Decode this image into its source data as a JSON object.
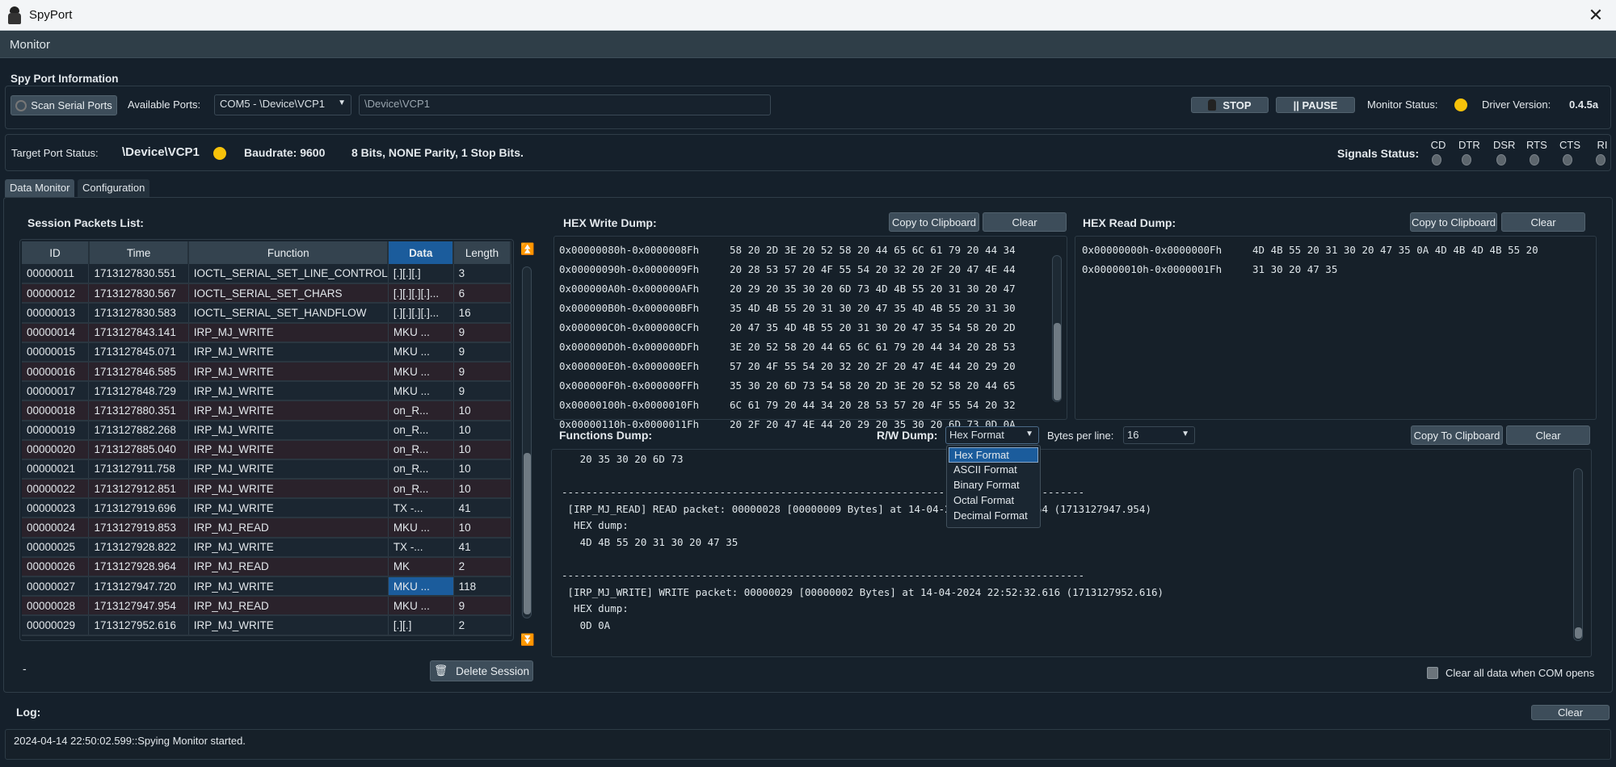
{
  "window": {
    "title": "SpyPort",
    "menu": "Monitor"
  },
  "spy_port": {
    "section_label": "Spy Port Information",
    "scan_button": "Scan Serial Ports",
    "available_ports_label": "Available Ports:",
    "selected_port": "COM5 - \\Device\\VCP1",
    "device_path": "\\Device\\VCP1",
    "stop_button": "STOP",
    "pause_button": "|| PAUSE",
    "monitor_status_label": "Monitor Status:",
    "monitor_status_color": "#f7c20a",
    "driver_version_label": "Driver Version:",
    "driver_version": "0.4.5a"
  },
  "target": {
    "label": "Target Port Status:",
    "device": "\\Device\\VCP1",
    "status_color": "#f7c20a",
    "baudrate": "Baudrate: 9600",
    "settings": "8 Bits, NONE Parity, 1 Stop Bits.",
    "signals_label": "Signals Status:",
    "signals": [
      "CD",
      "DTR",
      "DSR",
      "RTS",
      "CTS",
      "RI"
    ]
  },
  "tabs": [
    {
      "label": "Data Monitor",
      "active": true
    },
    {
      "label": "Configuration",
      "active": false
    }
  ],
  "session": {
    "title": "Session Packets List:",
    "columns": [
      "ID",
      "Time",
      "Function",
      "Data",
      "Length"
    ],
    "sorted_column": "Data",
    "rows": [
      [
        "00000011",
        "1713127830.551",
        "IOCTL_SERIAL_SET_LINE_CONTROL",
        "[.][.][.]",
        "3"
      ],
      [
        "00000012",
        "1713127830.567",
        "IOCTL_SERIAL_SET_CHARS",
        "[.][.][.][.]...",
        "6"
      ],
      [
        "00000013",
        "1713127830.583",
        "IOCTL_SERIAL_SET_HANDFLOW",
        "[.][.][.][.]...",
        "16"
      ],
      [
        "00000014",
        "1713127843.141",
        "IRP_MJ_WRITE",
        "MKU ...",
        "9"
      ],
      [
        "00000015",
        "1713127845.071",
        "IRP_MJ_WRITE",
        "MKU ...",
        "9"
      ],
      [
        "00000016",
        "1713127846.585",
        "IRP_MJ_WRITE",
        "MKU ...",
        "9"
      ],
      [
        "00000017",
        "1713127848.729",
        "IRP_MJ_WRITE",
        "MKU ...",
        "9"
      ],
      [
        "00000018",
        "1713127880.351",
        "IRP_MJ_WRITE",
        "on_R...",
        "10"
      ],
      [
        "00000019",
        "1713127882.268",
        "IRP_MJ_WRITE",
        "on_R...",
        "10"
      ],
      [
        "00000020",
        "1713127885.040",
        "IRP_MJ_WRITE",
        "on_R...",
        "10"
      ],
      [
        "00000021",
        "1713127911.758",
        "IRP_MJ_WRITE",
        "on_R...",
        "10"
      ],
      [
        "00000022",
        "1713127912.851",
        "IRP_MJ_WRITE",
        "on_R...",
        "10"
      ],
      [
        "00000023",
        "1713127919.696",
        "IRP_MJ_WRITE",
        "TX -...",
        "41"
      ],
      [
        "00000024",
        "1713127919.853",
        "IRP_MJ_READ",
        "MKU ...",
        "10"
      ],
      [
        "00000025",
        "1713127928.822",
        "IRP_MJ_WRITE",
        "TX -...",
        "41"
      ],
      [
        "00000026",
        "1713127928.964",
        "IRP_MJ_READ",
        "MK",
        "2"
      ],
      [
        "00000027",
        "1713127947.720",
        "IRP_MJ_WRITE",
        "MKU ...",
        "118"
      ],
      [
        "00000028",
        "1713127947.954",
        "IRP_MJ_READ",
        "MKU ...",
        "9"
      ],
      [
        "00000029",
        "1713127952.616",
        "IRP_MJ_WRITE",
        "[.][.]",
        "2"
      ]
    ],
    "selected_row": "00000027",
    "status": "-",
    "delete_button": "Delete Session"
  },
  "hex_write": {
    "title": "HEX Write Dump:",
    "copy_button": "Copy to Clipboard",
    "clear_button": "Clear",
    "lines": [
      [
        "0x00000080h-0x0000008Fh",
        "58 20 2D 3E 20 52 58 20 44 65 6C 61 79 20 44 34"
      ],
      [
        "0x00000090h-0x0000009Fh",
        "20 28 53 57 20 4F 55 54 20 32 20 2F 20 47 4E 44"
      ],
      [
        "0x000000A0h-0x000000AFh",
        "20 29 20 35 30 20 6D 73 4D 4B 55 20 31 30 20 47"
      ],
      [
        "0x000000B0h-0x000000BFh",
        "35 4D 4B 55 20 31 30 20 47 35 4D 4B 55 20 31 30"
      ],
      [
        "0x000000C0h-0x000000CFh",
        "20 47 35 4D 4B 55 20 31 30 20 47 35 54 58 20 2D"
      ],
      [
        "0x000000D0h-0x000000DFh",
        "3E 20 52 58 20 44 65 6C 61 79 20 44 34 20 28 53"
      ],
      [
        "0x000000E0h-0x000000EFh",
        "57 20 4F 55 54 20 32 20 2F 20 47 4E 44 20 29 20"
      ],
      [
        "0x000000F0h-0x000000FFh",
        "35 30 20 6D 73 54 58 20 2D 3E 20 52 58 20 44 65"
      ],
      [
        "0x00000100h-0x0000010Fh",
        "6C 61 79 20 44 34 20 28 53 57 20 4F 55 54 20 32"
      ],
      [
        "0x00000110h-0x0000011Fh",
        "20 2F 20 47 4E 44 20 29 20 35 30 20 6D 73 0D 0A"
      ]
    ]
  },
  "hex_read": {
    "title": "HEX Read Dump:",
    "copy_button": "Copy to Clipboard",
    "clear_button": "Clear",
    "lines": [
      [
        "0x00000000h-0x0000000Fh",
        "4D 4B 55 20 31 30 20 47 35 0A 4D 4B 4D 4B 55 20"
      ],
      [
        "0x00000010h-0x0000001Fh",
        "31 30 20 47 35"
      ]
    ]
  },
  "functions": {
    "title": "Functions Dump:",
    "rw_label": "R/W Dump:",
    "rw_value": "Hex Format",
    "rw_options": [
      "Hex Format",
      "ASCII Format",
      "Binary Format",
      "Octal Format",
      "Decimal Format"
    ],
    "bytes_label": "Bytes per line:",
    "bytes_value": "16",
    "copy_button": "Copy To Clipboard",
    "clear_button": "Clear",
    "text": "   20 35 30 20 6D 73\n\n--------------------------------------------------------------------------------------\n [IRP_MJ_READ] READ packet: 00000028 [00000009 Bytes] at 14-04-2024 22:52:27.954 (1713127947.954)\n  HEX dump:\n   4D 4B 55 20 31 30 20 47 35\n\n--------------------------------------------------------------------------------------\n [IRP_MJ_WRITE] WRITE packet: 00000029 [00000002 Bytes] at 14-04-2024 22:52:32.616 (1713127952.616)\n  HEX dump:\n   0D 0A",
    "clear_on_open_label": "Clear all data when COM opens",
    "clear_on_open_checked": false
  },
  "log": {
    "title": "Log:",
    "clear_button": "Clear",
    "lines": [
      "2024-04-14 22:50:02.599::Spying Monitor started."
    ]
  }
}
